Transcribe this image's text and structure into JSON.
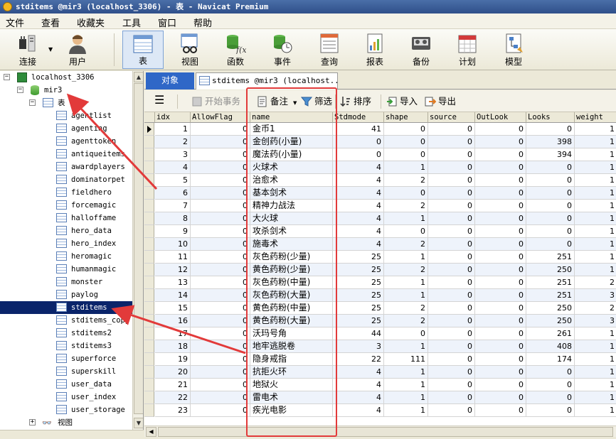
{
  "window": {
    "title": "stditems @mir3 (localhost_3306) - 表 - Navicat Premium"
  },
  "menu": [
    "文件",
    "查看",
    "收藏夹",
    "工具",
    "窗口",
    "帮助"
  ],
  "toolbar": [
    {
      "label": "连接",
      "icon": "plug-icon"
    },
    {
      "label": "用户",
      "icon": "user-icon"
    },
    {
      "label": "表",
      "icon": "table-icon",
      "active": true
    },
    {
      "label": "视图",
      "icon": "view-icon"
    },
    {
      "label": "函数",
      "icon": "function-icon"
    },
    {
      "label": "事件",
      "icon": "event-icon"
    },
    {
      "label": "查询",
      "icon": "query-icon"
    },
    {
      "label": "报表",
      "icon": "report-icon"
    },
    {
      "label": "备份",
      "icon": "backup-icon"
    },
    {
      "label": "计划",
      "icon": "schedule-icon"
    },
    {
      "label": "模型",
      "icon": "model-icon"
    }
  ],
  "tree": {
    "connection": "localhost_3306",
    "database": "mir3",
    "tables_label": "表",
    "tables": [
      "agentlist",
      "agenting",
      "agenttoken",
      "antiqueitems",
      "awardplayers",
      "dominatorpet",
      "fieldhero",
      "forcemagic",
      "halloffame",
      "hero_data",
      "hero_index",
      "heromagic",
      "humanmagic",
      "monster",
      "paylog",
      "stditems",
      "stditems_copy",
      "stditems2",
      "stditems3",
      "superforce",
      "superskill",
      "user_data",
      "user_index",
      "user_storage"
    ],
    "selected": "stditems",
    "views_label": "视图"
  },
  "tabs": {
    "objects": "对象",
    "active": "stditems @mir3 (localhost..."
  },
  "grid_toolbar": {
    "begin_transaction": "开始事务",
    "memo": "备注",
    "filter": "筛选",
    "sort": "排序",
    "import": "导入",
    "export": "导出"
  },
  "grid": {
    "columns": [
      "idx",
      "AllowFlag",
      "name",
      "Stdmode",
      "shape",
      "source",
      "OutLook",
      "Looks",
      "weight"
    ],
    "rows": [
      [
        "1",
        "0",
        "金币1",
        "41",
        "0",
        "0",
        "0",
        "0",
        "1"
      ],
      [
        "2",
        "0",
        "金创药(小量)",
        "0",
        "0",
        "0",
        "0",
        "398",
        "1"
      ],
      [
        "3",
        "0",
        "魔法药(小量)",
        "0",
        "0",
        "0",
        "0",
        "394",
        "1"
      ],
      [
        "4",
        "0",
        "火球术",
        "4",
        "1",
        "0",
        "0",
        "0",
        "1"
      ],
      [
        "5",
        "0",
        "治愈术",
        "4",
        "2",
        "0",
        "0",
        "0",
        "1"
      ],
      [
        "6",
        "0",
        "基本剑术",
        "4",
        "0",
        "0",
        "0",
        "0",
        "1"
      ],
      [
        "7",
        "0",
        "精神力战法",
        "4",
        "2",
        "0",
        "0",
        "0",
        "1"
      ],
      [
        "8",
        "0",
        "大火球",
        "4",
        "1",
        "0",
        "0",
        "0",
        "1"
      ],
      [
        "9",
        "0",
        "攻杀剑术",
        "4",
        "0",
        "0",
        "0",
        "0",
        "1"
      ],
      [
        "10",
        "0",
        "施毒术",
        "4",
        "2",
        "0",
        "0",
        "0",
        "1"
      ],
      [
        "11",
        "0",
        "灰色药粉(少量)",
        "25",
        "1",
        "0",
        "0",
        "251",
        "1"
      ],
      [
        "12",
        "0",
        "黄色药粉(少量)",
        "25",
        "2",
        "0",
        "0",
        "250",
        "1"
      ],
      [
        "13",
        "0",
        "灰色药粉(中量)",
        "25",
        "1",
        "0",
        "0",
        "251",
        "2"
      ],
      [
        "14",
        "0",
        "灰色药粉(大量)",
        "25",
        "1",
        "0",
        "0",
        "251",
        "3"
      ],
      [
        "15",
        "0",
        "黄色药粉(中量)",
        "25",
        "2",
        "0",
        "0",
        "250",
        "2"
      ],
      [
        "16",
        "0",
        "黄色药粉(大量)",
        "25",
        "2",
        "0",
        "0",
        "250",
        "3"
      ],
      [
        "17",
        "0",
        "沃玛号角",
        "44",
        "0",
        "0",
        "0",
        "261",
        "1"
      ],
      [
        "18",
        "0",
        "地牢逃脱卷",
        "3",
        "1",
        "0",
        "0",
        "408",
        "1"
      ],
      [
        "19",
        "0",
        "隐身戒指",
        "22",
        "111",
        "0",
        "0",
        "174",
        "1"
      ],
      [
        "20",
        "0",
        "抗拒火环",
        "4",
        "1",
        "0",
        "0",
        "0",
        "1"
      ],
      [
        "21",
        "0",
        "地狱火",
        "4",
        "1",
        "0",
        "0",
        "0",
        "1"
      ],
      [
        "22",
        "0",
        "雷电术",
        "4",
        "1",
        "0",
        "0",
        "0",
        "1"
      ],
      [
        "23",
        "0",
        "疾光电影",
        "4",
        "1",
        "0",
        "0",
        "0",
        "1"
      ]
    ]
  },
  "colors": {
    "highlight": "#e23a3a",
    "selection": "#0a246a",
    "accent": "#2f67c7"
  }
}
